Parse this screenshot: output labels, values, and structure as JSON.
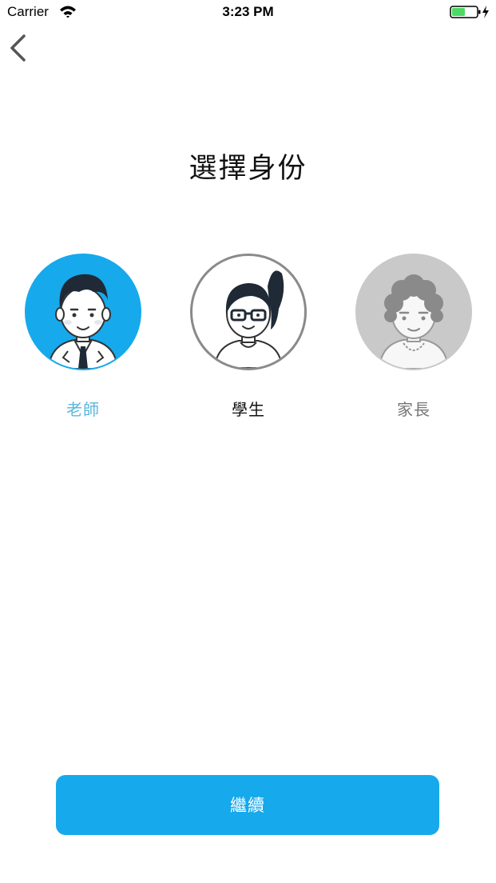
{
  "status_bar": {
    "carrier": "Carrier",
    "time": "3:23 PM",
    "wifi_icon": "wifi-icon",
    "battery_icon": "battery-charging-icon",
    "battery_color": "#4cd964"
  },
  "nav": {
    "back_icon": "chevron-left-icon"
  },
  "page": {
    "title": "選擇身份"
  },
  "roles": [
    {
      "label": "老師",
      "icon": "teacher-avatar-icon",
      "selected": true,
      "label_color": "#5ab6dd",
      "avatar_bg": "#16a9ec"
    },
    {
      "label": "學生",
      "icon": "student-avatar-icon",
      "selected": false,
      "label_color": "#111111",
      "avatar_bg": "#ffffff"
    },
    {
      "label": "家長",
      "icon": "parent-avatar-icon",
      "selected": false,
      "label_color": "#777777",
      "avatar_bg": "#c9c9c9"
    }
  ],
  "footer": {
    "continue_label": "繼續",
    "accent_color": "#16a9ec"
  }
}
